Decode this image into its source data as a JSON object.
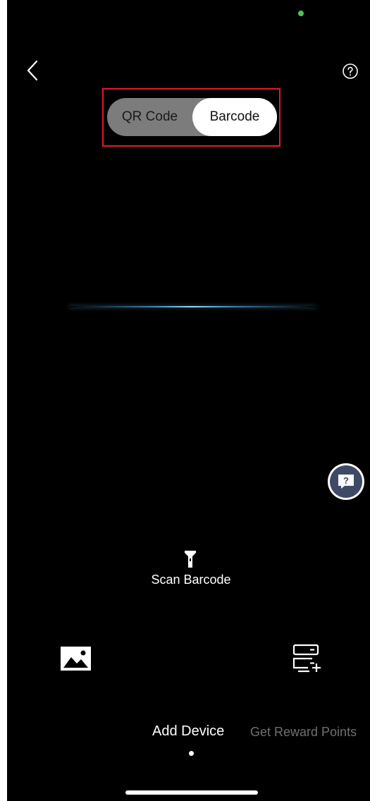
{
  "header": {
    "back_icon": "chevron-left-icon",
    "help_icon": "question-circle-icon"
  },
  "scan_mode_toggle": {
    "options": [
      "QR Code",
      "Barcode"
    ],
    "selected": "Barcode"
  },
  "floating_help": {
    "label": "?",
    "icon": "chat-question-icon"
  },
  "scan_action": {
    "icon": "flashlight-icon",
    "label": "Scan Barcode"
  },
  "bottom_actions": {
    "gallery_icon": "image-gallery-icon",
    "add_device_icon": "server-add-icon"
  },
  "bottom_tabs": {
    "items": [
      "Add Device",
      "Get Reward Points"
    ],
    "active": "Add Device"
  },
  "colors": {
    "background": "#000000",
    "highlight_border": "#e21b2a",
    "toggle_track": "#7c7c7c",
    "scan_line": "#8fd3ef",
    "status_dot": "#4fc05a"
  }
}
